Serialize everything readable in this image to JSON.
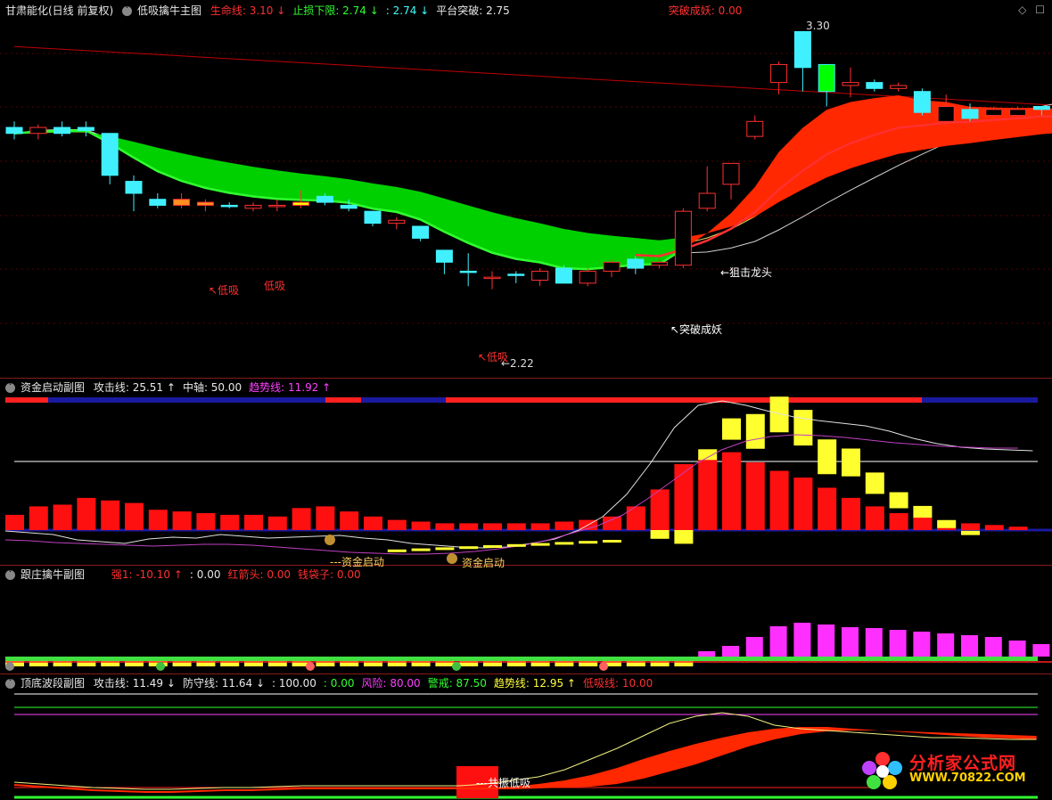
{
  "main": {
    "stock": "甘肃能化(日线 前复权)",
    "indicator": "低吸擒牛主图",
    "fields": [
      {
        "label": "生命线: 3.10",
        "arrow": "↓",
        "color": "#ff3030"
      },
      {
        "label": "止损下限: 2.74",
        "arrow": "↓",
        "color": "#30ff30"
      },
      {
        "label": ": 2.74",
        "arrow": "↓",
        "color": "#40ffff"
      },
      {
        "label": "平台突破: 2.75",
        "arrow": "",
        "color": "#e8e8e8"
      },
      {
        "label": "突破成妖: 0.00",
        "arrow": "",
        "color": "#ff3030"
      }
    ],
    "annotations": {
      "high": "3.30",
      "low": "←2.22",
      "dragon": "←狙击龙头",
      "breakout": "↖突破成妖",
      "buy1": "↖低吸",
      "buy2": "低吸",
      "buy3": "↖低吸"
    }
  },
  "panel2": {
    "title": "资金启动副图",
    "fields": [
      {
        "label": "攻击线: 25.51",
        "arrow": "↑",
        "color": "#e8e8e8"
      },
      {
        "label": "中轴: 50.00",
        "arrow": "",
        "color": "#e8e8e8"
      },
      {
        "label": "趋势线: 11.92",
        "arrow": "↑",
        "color": "#ff40ff"
      }
    ],
    "annotations": {
      "start1": "---资金启动",
      "start2": "资金启动"
    }
  },
  "panel3": {
    "title": "跟庄擒牛副图",
    "fields": [
      {
        "label": "强1: -10.10",
        "arrow": "↑",
        "color": "#ff3030"
      },
      {
        "label": ": 0.00",
        "arrow": "",
        "color": "#e8e8e8"
      },
      {
        "label": "红箭头: 0.00",
        "arrow": "",
        "color": "#ff3030"
      },
      {
        "label": "钱袋子: 0.00",
        "arrow": "",
        "color": "#ff3030"
      }
    ]
  },
  "panel4": {
    "title": "顶底波段副图",
    "fields": [
      {
        "label": "攻击线: 11.49",
        "arrow": "↓",
        "color": "#e8e8e8"
      },
      {
        "label": "防守线: 11.64",
        "arrow": "↓",
        "color": "#e8e8e8"
      },
      {
        "label": ": 100.00",
        "arrow": "",
        "color": "#e8e8e8"
      },
      {
        "label": ": 0.00",
        "arrow": "",
        "color": "#30ff30"
      },
      {
        "label": "风险: 80.00",
        "arrow": "",
        "color": "#ff40ff"
      },
      {
        "label": "警戒: 87.50",
        "arrow": "",
        "color": "#30ff30"
      },
      {
        "label": "趋势线: 12.95",
        "arrow": "↑",
        "color": "#ffff40"
      },
      {
        "label": "低吸线: 10.00",
        "arrow": "",
        "color": "#ff3030"
      }
    ],
    "annotations": {
      "resonance": "---共振低吸"
    }
  },
  "watermark": {
    "title": "分析家公式网",
    "url": "WWW.70822.COM"
  },
  "chart_data": {
    "type": "candlestick",
    "series_candles": [
      {
        "o": 2.98,
        "c": 2.96,
        "h": 3.0,
        "l": 2.94,
        "up": false
      },
      {
        "o": 2.96,
        "c": 2.98,
        "h": 2.99,
        "l": 2.94,
        "up": true
      },
      {
        "o": 2.96,
        "c": 2.98,
        "h": 3.0,
        "l": 2.95,
        "up": false
      },
      {
        "o": 2.98,
        "c": 2.97,
        "h": 3.0,
        "l": 2.95,
        "up": false
      },
      {
        "o": 2.96,
        "c": 2.82,
        "h": 2.96,
        "l": 2.79,
        "up": false
      },
      {
        "o": 2.8,
        "c": 2.76,
        "h": 2.82,
        "l": 2.7,
        "up": false
      },
      {
        "o": 2.74,
        "c": 2.72,
        "h": 2.76,
        "l": 2.71,
        "up": false
      },
      {
        "o": 2.74,
        "c": 2.72,
        "h": 2.76,
        "l": 2.71,
        "up": true,
        "fill": "#ff9020"
      },
      {
        "o": 2.73,
        "c": 2.72,
        "h": 2.74,
        "l": 2.7,
        "up": true,
        "fill": "#ff9020"
      },
      {
        "o": 2.72,
        "c": 2.72,
        "h": 2.73,
        "l": 2.71,
        "up": false
      },
      {
        "o": 2.71,
        "c": 2.72,
        "h": 2.73,
        "l": 2.7,
        "up": true
      },
      {
        "o": 2.72,
        "c": 2.72,
        "h": 2.74,
        "l": 2.7,
        "up": true
      },
      {
        "o": 2.72,
        "c": 2.73,
        "h": 2.77,
        "l": 2.71,
        "up": true,
        "fill": "#ffff00"
      },
      {
        "o": 2.75,
        "c": 2.73,
        "h": 2.76,
        "l": 2.72,
        "up": false
      },
      {
        "o": 2.72,
        "c": 2.71,
        "h": 2.74,
        "l": 2.7,
        "up": false
      },
      {
        "o": 2.7,
        "c": 2.66,
        "h": 2.7,
        "l": 2.65,
        "up": false
      },
      {
        "o": 2.66,
        "c": 2.67,
        "h": 2.68,
        "l": 2.64,
        "up": true
      },
      {
        "o": 2.65,
        "c": 2.61,
        "h": 2.65,
        "l": 2.6,
        "up": false
      },
      {
        "o": 2.57,
        "c": 2.53,
        "h": 2.57,
        "l": 2.49,
        "up": false
      },
      {
        "o": 2.5,
        "c": 2.5,
        "h": 2.56,
        "l": 2.45,
        "up": false
      },
      {
        "o": 2.48,
        "c": 2.48,
        "h": 2.5,
        "l": 2.44,
        "up": true
      },
      {
        "o": 2.49,
        "c": 2.49,
        "h": 2.5,
        "l": 2.46,
        "up": false
      },
      {
        "o": 2.47,
        "c": 2.5,
        "h": 2.51,
        "l": 2.45,
        "up": true
      },
      {
        "o": 2.51,
        "c": 2.46,
        "h": 2.52,
        "l": 2.46,
        "up": false
      },
      {
        "o": 2.46,
        "c": 2.5,
        "h": 2.51,
        "l": 2.45,
        "up": true
      },
      {
        "o": 2.5,
        "c": 2.53,
        "h": 2.54,
        "l": 2.48,
        "up": true
      },
      {
        "o": 2.51,
        "c": 2.54,
        "h": 2.55,
        "l": 2.49,
        "up": false
      },
      {
        "o": 2.52,
        "c": 2.53,
        "h": 2.56,
        "l": 2.51,
        "up": true
      },
      {
        "o": 2.52,
        "c": 2.7,
        "h": 2.71,
        "l": 2.51,
        "up": true
      },
      {
        "o": 2.71,
        "c": 2.76,
        "h": 2.85,
        "l": 2.7,
        "up": true
      },
      {
        "o": 2.79,
        "c": 2.86,
        "h": 2.86,
        "l": 2.74,
        "up": true
      },
      {
        "o": 2.95,
        "c": 3.0,
        "h": 3.02,
        "l": 2.94,
        "up": true
      },
      {
        "o": 3.13,
        "c": 3.19,
        "h": 3.2,
        "l": 3.09,
        "up": true
      },
      {
        "o": 3.3,
        "c": 3.18,
        "h": 3.3,
        "l": 3.1,
        "up": false
      },
      {
        "o": 3.1,
        "c": 3.19,
        "h": 3.19,
        "l": 3.05,
        "up": false,
        "fill": "#00ff00"
      },
      {
        "o": 3.12,
        "c": 3.13,
        "h": 3.18,
        "l": 3.08,
        "up": true
      },
      {
        "o": 3.13,
        "c": 3.11,
        "h": 3.14,
        "l": 3.1,
        "up": false
      },
      {
        "o": 3.12,
        "c": 3.11,
        "h": 3.13,
        "l": 3.1,
        "up": true
      },
      {
        "o": 3.1,
        "c": 3.03,
        "h": 3.11,
        "l": 3.02,
        "up": false
      },
      {
        "o": 3.0,
        "c": 3.05,
        "h": 3.09,
        "l": 2.99,
        "up": true
      },
      {
        "o": 3.04,
        "c": 3.01,
        "h": 3.06,
        "l": 3.0,
        "up": false
      },
      {
        "o": 3.02,
        "c": 3.04,
        "h": 3.05,
        "l": 3.01,
        "up": true
      },
      {
        "o": 3.02,
        "c": 3.04,
        "h": 3.05,
        "l": 3.01,
        "up": true
      },
      {
        "o": 3.04,
        "c": 3.05,
        "h": 3.05,
        "l": 3.02,
        "up": false
      },
      {
        "o": 3.0,
        "c": 3.02,
        "h": 3.04,
        "l": 3.0,
        "up": true
      }
    ],
    "ylim": [
      2.18,
      3.34
    ]
  }
}
